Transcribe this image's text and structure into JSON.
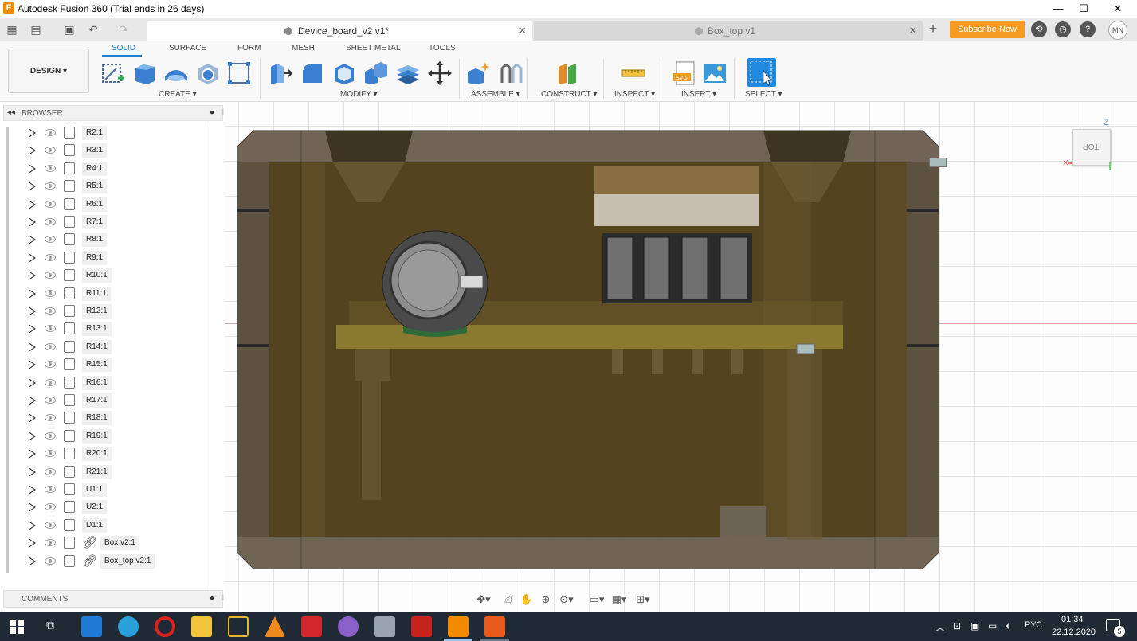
{
  "window": {
    "title": "Autodesk Fusion 360 (Trial ends in 26 days)",
    "app_icon_letter": "F",
    "controls": {
      "minimize": "—",
      "maximize": "☐",
      "close": "✕"
    }
  },
  "tabs": [
    {
      "label": "Device_board_v2 v1*",
      "active": true,
      "close": "×"
    },
    {
      "label": "Box_top v1",
      "active": false,
      "close": "×"
    }
  ],
  "tabbar": {
    "add": "+",
    "subscribe": "Subscribe Now",
    "user_initials": "MN"
  },
  "toolbar": {
    "design_button": "DESIGN ▾",
    "workspace_tabs": [
      "SOLID",
      "SURFACE",
      "FORM",
      "MESH",
      "SHEET METAL",
      "TOOLS"
    ],
    "active_workspace": "SOLID",
    "groups": {
      "create": "CREATE ▾",
      "modify": "MODIFY ▾",
      "assemble": "ASSEMBLE ▾",
      "construct": "CONSTRUCT ▾",
      "inspect": "INSPECT ▾",
      "insert": "INSERT ▾",
      "select": "SELECT ▾"
    }
  },
  "browser": {
    "title": "BROWSER",
    "items": [
      {
        "label": "R2:1",
        "linked": false
      },
      {
        "label": "R3:1",
        "linked": false
      },
      {
        "label": "R4:1",
        "linked": false
      },
      {
        "label": "R5:1",
        "linked": false
      },
      {
        "label": "R6:1",
        "linked": false
      },
      {
        "label": "R7:1",
        "linked": false
      },
      {
        "label": "R8:1",
        "linked": false
      },
      {
        "label": "R9:1",
        "linked": false
      },
      {
        "label": "R10:1",
        "linked": false
      },
      {
        "label": "R11:1",
        "linked": false
      },
      {
        "label": "R12:1",
        "linked": false
      },
      {
        "label": "R13:1",
        "linked": false
      },
      {
        "label": "R14:1",
        "linked": false
      },
      {
        "label": "R15:1",
        "linked": false
      },
      {
        "label": "R16:1",
        "linked": false
      },
      {
        "label": "R17:1",
        "linked": false
      },
      {
        "label": "R18:1",
        "linked": false
      },
      {
        "label": "R19:1",
        "linked": false
      },
      {
        "label": "R20:1",
        "linked": false
      },
      {
        "label": "R21:1",
        "linked": false
      },
      {
        "label": "U1:1",
        "linked": false
      },
      {
        "label": "U2:1",
        "linked": false
      },
      {
        "label": "D1:1",
        "linked": false
      },
      {
        "label": "Box v2:1",
        "linked": true
      },
      {
        "label": "Box_top v2:1",
        "linked": true
      }
    ]
  },
  "comments": {
    "title": "COMMENTS"
  },
  "viewcube": {
    "face": "TOP",
    "axis_z": "Z",
    "axis_x": "X"
  },
  "taskbar": {
    "language": "РУС",
    "time": "01:34",
    "date": "22.12.2020",
    "notifications": "5"
  }
}
